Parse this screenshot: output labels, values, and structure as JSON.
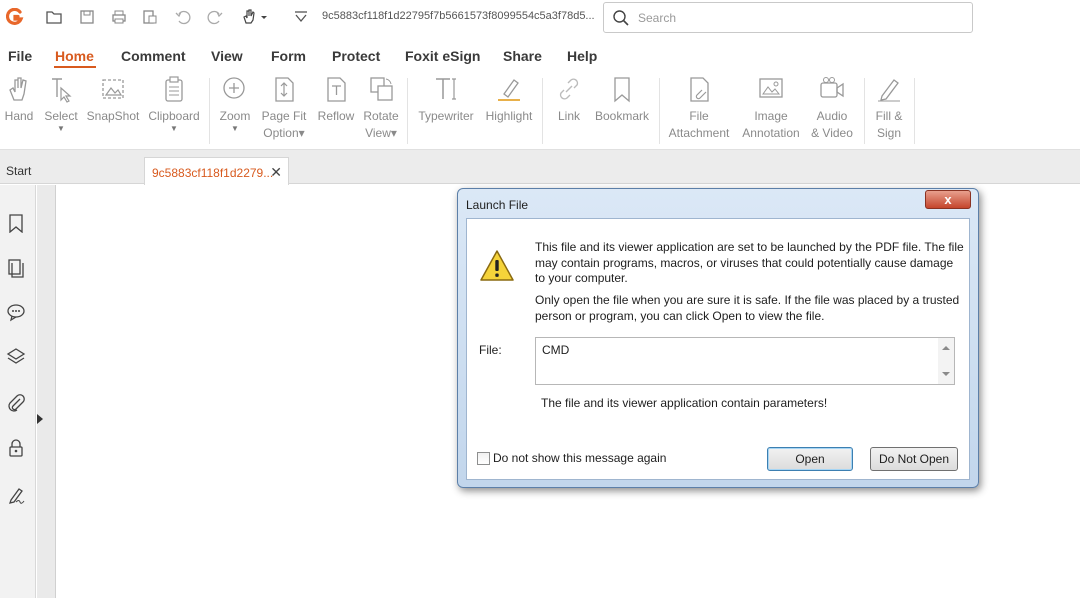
{
  "app": {
    "doc_title": "9c5883cf118f1d22795f7b5661573f8099554c5a3f78d5...",
    "search_placeholder": "Search",
    "accent": "#d85a1e"
  },
  "menu": [
    "File",
    "Home",
    "Comment",
    "View",
    "Form",
    "Protect",
    "Foxit eSign",
    "Share",
    "Help"
  ],
  "ribbon": {
    "hand": "Hand",
    "select": "Select",
    "snapshot": "SnapShot",
    "clipboard": "Clipboard",
    "zoom": "Zoom",
    "page_fit_1": "Page Fit",
    "page_fit_2": "Option",
    "reflow": "Reflow",
    "rotate_1": "Rotate",
    "rotate_2": "View",
    "typewriter": "Typewriter",
    "highlight": "Highlight",
    "link": "Link",
    "bookmark": "Bookmark",
    "file_att_1": "File",
    "file_att_2": "Attachment",
    "img_ann_1": "Image",
    "img_ann_2": "Annotation",
    "audio_1": "Audio",
    "audio_2": "& Video",
    "fill_1": "Fill &",
    "fill_2": "Sign"
  },
  "tabs": {
    "start": "Start",
    "doc": "9c5883cf118f1d2279..."
  },
  "dialog": {
    "title": "Launch File",
    "close": "x",
    "message_1": "This file and its viewer application are set to be launched by the PDF file. The file may contain programs, macros, or viruses that could potentially cause damage to your computer.",
    "message_2": "Only open the file when you are sure it is safe. If the file was placed by a trusted person or program, you can click Open to view the file.",
    "file_label": "File:",
    "file_value": "CMD",
    "params_note": "The file and its viewer application contain parameters!",
    "checkbox_label": "Do not show this message again",
    "open": "Open",
    "do_not_open": "Do Not Open"
  }
}
